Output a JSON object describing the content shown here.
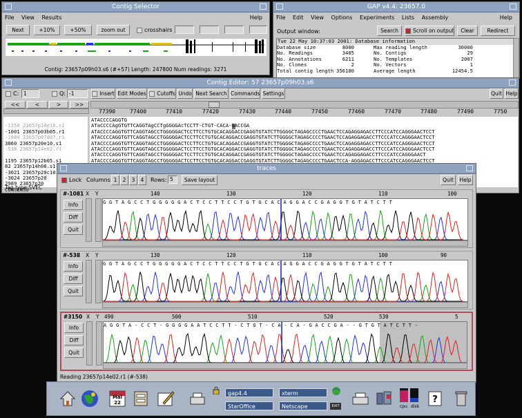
{
  "contig_selector": {
    "title": "Contig Selector",
    "menu": [
      "File",
      "View",
      "Results"
    ],
    "help": "Help",
    "buttons": {
      "next": "Next",
      "zoom10": "+10%",
      "zoom50": "+50%",
      "zoom_out": "zoom out"
    },
    "crosshairs_label": "crosshairs",
    "status": "Contig: 23657p09h03.s6 (#+57)  Length: 247800  Num readings: 3271"
  },
  "gap": {
    "title": "GAP v4.4: 23657.0",
    "menu": [
      "File",
      "Edit",
      "View",
      "Options",
      "Experiments",
      "Lists",
      "Assembly"
    ],
    "help": "Help",
    "output_label": "Output window:",
    "search_label": "Search",
    "scroll_label": "Scroll on output",
    "clear_label": "Clear",
    "redirect_label": "Redirect",
    "info_header": "Tue 22 May 10:37:03 2001: Database information",
    "info_rows": [
      {
        "l": "Database size",
        "lv": "8000",
        "r": "Max reading length",
        "rv": "30000"
      },
      {
        "l": "No. Readings",
        "lv": "3405",
        "r": "No. Contigs",
        "rv": "29"
      },
      {
        "l": "No. Annotations",
        "lv": "6211",
        "r": "No. Templates",
        "rv": "2007"
      },
      {
        "l": "No. Clones",
        "lv": "2",
        "r": "No. Vectors",
        "rv": "1"
      },
      {
        "l": "Total contig length",
        "lv": "356180",
        "r": "Average length",
        "rv": "12454.5"
      }
    ]
  },
  "contig_editor": {
    "title": "Contig Editor:  57 23657p09h03.s6",
    "c_label": "C:",
    "c_value": "1",
    "q_label": "Q:",
    "q_value": "-1",
    "buttons": {
      "insert": "Insert",
      "edit_modes": "Edit Modes",
      "cutoffs": "Cutoffs",
      "undo": "Undo",
      "next_search": "Next Search",
      "commands": "Commands",
      "settings": "Settings",
      "quit": "Quit",
      "help": "Help"
    },
    "nav": [
      "<<",
      "<",
      ">",
      ">>"
    ],
    "ruler": [
      "77390",
      "77400",
      "77410",
      "77420",
      "77430",
      "77440",
      "77450",
      "77460",
      "77470",
      "77480",
      "77490",
      "7750"
    ],
    "rows": [
      {
        "name": "",
        "seq": "ATACCCCAGGTG"
      },
      {
        "name": "",
        "seq": "ATaCCCCAgGTGTTCAGGTAgCCTgGGGGAcTCCTT-CTGT-CACA-GACCGA"
      },
      {
        "name": "-1001 23657p03b05.r1",
        "seq": "ATACCCCAGGTGTTCAGGTAGCCTGGGGGACTCCTTCCTGTGCACAGGACCGAGGTGTATCTTGGGGCTAGAGCCCCTGAACTCCAGAGGAGACCTTCCCATCCAGGGAACTCCT"
      },
      {
        "name": "",
        "seq": "ATACCCCAGGTGTTCAGGTAGCCTGGGGGACTCCTTCCTGTGCACAGGACCGAGGTGTATCTTGGGGCTAGAGCCCCTGAACTCCAGAGGAGACCTTCCCATCCAGGGAACTCCT"
      },
      {
        "name": "3060 23657p20e10.s1",
        "seq": "ATACCCCAGGTGTTCAGGTAGCCTGGGGGACTCCTTCCTGTGCACAGGACCGAGGTGTATCTTGGGGCTAGAGCCCCTGAACTCCAGAGGAGACCTTCCCATCCAGGGAACTCCT"
      },
      {
        "name": "",
        "seq": "ATACCCCAGGTGTTCAGGTAGCCTGGGGGACTCCTTCCTGTGCACAGGACCGAGGTGTATCTTGGGGCTAGAGCCCCTGAACTCCAGAGGAGACCTTCCCATCCAGGGAACTCCT"
      },
      {
        "name": "",
        "seq": "ATACCCCAGGTGTTCAGGTAGCCTGGGGGACTCCTTCCTGTGCACAGGACCGAGGTGTATCTTGGGGCTAGAGCCCCTGAACTCCAGAGGAGACCTTCCCATCCAGGGAACT"
      },
      {
        "name": "1195 23657p12b05.s1",
        "seq": "ATACCCCAGGTGTTCAGGTAGCCTGGGGGACTCCTTCCTGTGCACAGGACCGAGGTGTATCTTGGGGCTAGAGCCCCTGAACTCCA-AGGAGACCTTCCCATCCAGGGAACTCCT"
      },
      {
        "name": "82 23657p14h08.s1",
        "seq": "ATACCCCAGGTGTTCAGGTA-CCTGGGGGACTCCTTCCTGTGCACAGGACCGAGGTGTATCTTGGGGCTAGAgCCCC-GAA-TcCA-AGGAGA-CTT-CC-TCCA-GGAACTCCT"
      },
      {
        "name": "-3021 23657p20c10.s1",
        "seq": "ATACCCCAGGTGTTCAGGTAGCCTGGGGGACTCCTTCCTGTGCACAGGACCGAGGTGTATCTTGGGGCTAGAGCCCCTGAACTCCAGAGGAGACCTTCCCATCCAGGGAACTCCT"
      },
      {
        "name": "-3024 23657p20",
        "seq": ""
      },
      {
        "name": "2989 23657p20",
        "seq": ""
      },
      {
        "name": "CONSENSU",
        "seq": ""
      }
    ],
    "tag_type": "Tag type:SVEC",
    "dim_names": [
      "-1150 23657p10e16.s1",
      "-1084 23657p07d07.r1",
      "-538 23657p14e02.r1"
    ]
  },
  "traces": {
    "title": "traces",
    "lock_label": "Lock",
    "columns_label": "Columns:",
    "columns": [
      "1",
      "2",
      "3",
      "4"
    ],
    "rows_label": "Rows:",
    "rows_value": "5",
    "save_layout": "Save layout",
    "quit": "Quit",
    "help": "Help",
    "x_label": "X",
    "y_label": "Y",
    "info_btn": "Info",
    "diff_btn": "Diff",
    "quit_btn": "Quit",
    "panels": [
      {
        "id": "#-1081",
        "ticks": [
          "140",
          "130",
          "120",
          "110",
          "100"
        ],
        "bases": "GGTAGCCTGGGGGACTCCTTCCTGTGCACAGGACCGAGGTGTATCTT",
        "selected": false
      },
      {
        "id": "#-538",
        "ticks": [
          "130",
          "120",
          "110",
          "100",
          "90"
        ],
        "bases": "GGTAGCCTGGGGGACTCCTTCCTGTGCACAGGACCGAGGTGTATCTT",
        "selected": false
      },
      {
        "id": "#3150",
        "ticks": [
          "490",
          "500",
          "510",
          "520",
          "530",
          "5"
        ],
        "bases": "AGGTA-CCT-GGGGAATCCTT-CTGT-CA-CA-GACCGA--GTGTATCTT-",
        "selected": true
      }
    ],
    "status": "Reading 23657p14e02.r1 (#-538)"
  },
  "taskbar": {
    "calendar_day": "Mai",
    "calendar_date": "22",
    "windows": [
      "gap4.4",
      "xterm",
      "StarOffice",
      "Netscape"
    ],
    "exit_label": "EXIT",
    "cpu_label": "cpu",
    "disk_label": "disk"
  },
  "colors": {
    "title_bg": "#8ea3c0",
    "window_bg": "#c8c8c8",
    "trace_A": "#1aa01a",
    "trace_C": "#2030e0",
    "trace_G": "#000000",
    "trace_T": "#e02020",
    "taskbar": "#a9b4c5"
  }
}
